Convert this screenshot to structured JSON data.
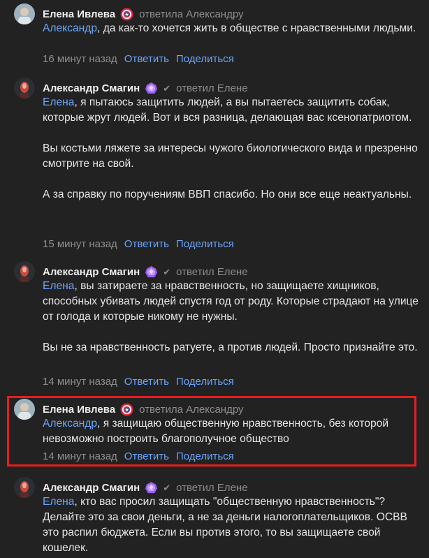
{
  "colors": {
    "background": "#222222",
    "link": "#6aa6ff",
    "muted": "#8e8e8e",
    "highlight_border": "#e61e1e"
  },
  "actions": {
    "reply": "Ответить",
    "share": "Поделиться"
  },
  "comments": [
    {
      "author": "Елена Ивлева",
      "badge_icon": "captain-america-shield-icon",
      "verified": false,
      "reply_info": "ответила Александру",
      "mention": "Александр",
      "paragraphs": [
        ", да как-то хочется жить в обществе с нравственными людьми."
      ],
      "time": "16 минут назад"
    },
    {
      "author": "Александр Смагин",
      "badge_icon": "purple-gem-icon",
      "verified": true,
      "reply_info": "ответил Елене",
      "mention": "Елена",
      "paragraphs": [
        ", я пытаюсь защитить людей, а вы пытаетесь защитить собак, которые жрут людей. Вот и вся разница, делающая вас ксенопатриотом.",
        "Вы костьми ляжете за интересы чужого биологического вида и презренно смотрите на свой.",
        "А за справку по поручениям ВВП спасибо. Но они все еще неактуальны."
      ],
      "time": "15 минут назад"
    },
    {
      "author": "Александр Смагин",
      "badge_icon": "purple-gem-icon",
      "verified": true,
      "reply_info": "ответил Елене",
      "mention": "Елена",
      "paragraphs": [
        ", вы затираете за нравственность, но защищаете хищников, способных убивать людей спустя год от роду. Которые страдают на улице от голода и которые никому не нужны.",
        "Вы не за нравственность ратуете, а против людей. Просто признайте это."
      ],
      "time": "14 минут назад"
    },
    {
      "author": "Елена Ивлева",
      "badge_icon": "captain-america-shield-icon",
      "verified": false,
      "reply_info": "ответила Александру",
      "mention": "Александр",
      "paragraphs": [
        ", я защищаю общественную нравственность, без которой невозможно построить благополучное общество"
      ],
      "time": "14 минут назад"
    },
    {
      "author": "Александр Смагин",
      "badge_icon": "purple-gem-icon",
      "verified": true,
      "reply_info": "ответил Елене",
      "mention": "Елена",
      "paragraphs": [
        ", кто вас просил защищать \"общественную нравственность\"? Делайте это за свои деньги, а не за деньги налогоплательщиков. ОСВВ это распил бюджета. Если вы против этого, то вы защищаете свой кошелек."
      ],
      "time": ""
    }
  ]
}
